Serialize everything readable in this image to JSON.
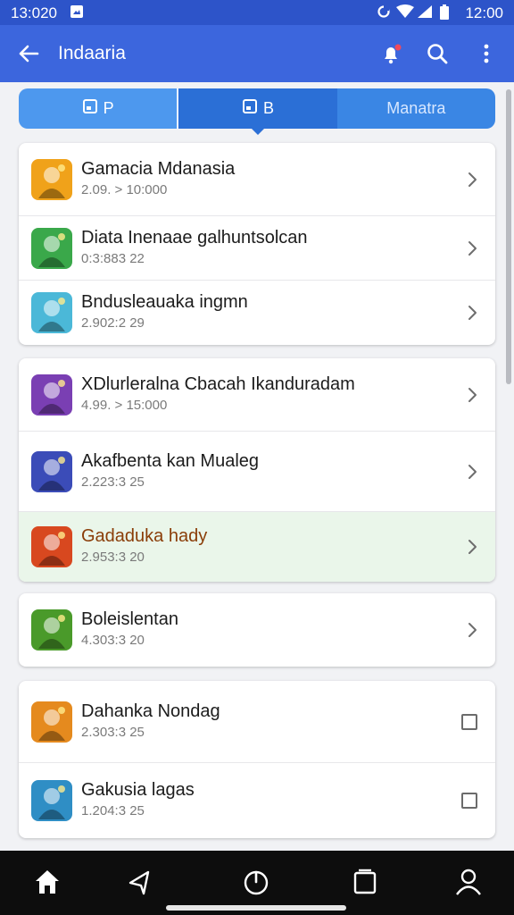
{
  "status_bar": {
    "time": "13:0⁠20",
    "clock": "12:00"
  },
  "app_bar": {
    "title": "Indaaria",
    "back_icon": "arrow-left-icon",
    "actions": [
      "notification-bell-icon",
      "search-icon",
      "more-vert-icon"
    ]
  },
  "tabs": [
    {
      "label": "P",
      "icon": "tablet-icon"
    },
    {
      "label": "B",
      "icon": "tablet-icon"
    },
    {
      "label": "Manatra"
    }
  ],
  "groups": [
    {
      "items": [
        {
          "name": "Gamacia Mdanasia",
          "sub": "2.09. > 10:000",
          "trail": "chevron",
          "color": "#f0a21a"
        },
        {
          "name": "Diata Inenaae galhuntsolcan",
          "sub": "0:3:883 22",
          "trail": "chevron",
          "color": "#3aa84a"
        },
        {
          "name": "Bndusleauaka ingmn",
          "sub": "2.902:2 29",
          "trail": "chevron",
          "color": "#4bb8d8"
        }
      ]
    },
    {
      "items": [
        {
          "name": "XDlurleralna Cbacah Ikanduradam",
          "sub": "4.99. > 15:000",
          "trail": "chevron",
          "color": "#7a3fb3"
        },
        {
          "name": "Akafbenta kan Mualeg",
          "sub": "2.223:3 25",
          "trail": "chevron",
          "color": "#3b4cb8"
        },
        {
          "name": "Gadaduka hady",
          "sub": "2.953:3 20",
          "trail": "chevron",
          "tint": true,
          "color": "#d8481f"
        }
      ]
    },
    {
      "items": [
        {
          "name": "Boleislentan",
          "sub": "4.303:3 20",
          "trail": "chevron",
          "color": "#4a9a2a"
        }
      ]
    },
    {
      "items": [
        {
          "name": "Dahanka Nondag",
          "sub": "2.303:3 25",
          "trail": "checkbox",
          "color": "#e58a1e"
        },
        {
          "name": "Gakusia lagas",
          "sub": "1.204:3 25",
          "trail": "checkbox",
          "color": "#2f8ec5"
        }
      ]
    }
  ],
  "bottom_nav": [
    "home-icon",
    "back-triangle-icon",
    "power-icon",
    "recents-icon",
    "profile-icon"
  ]
}
